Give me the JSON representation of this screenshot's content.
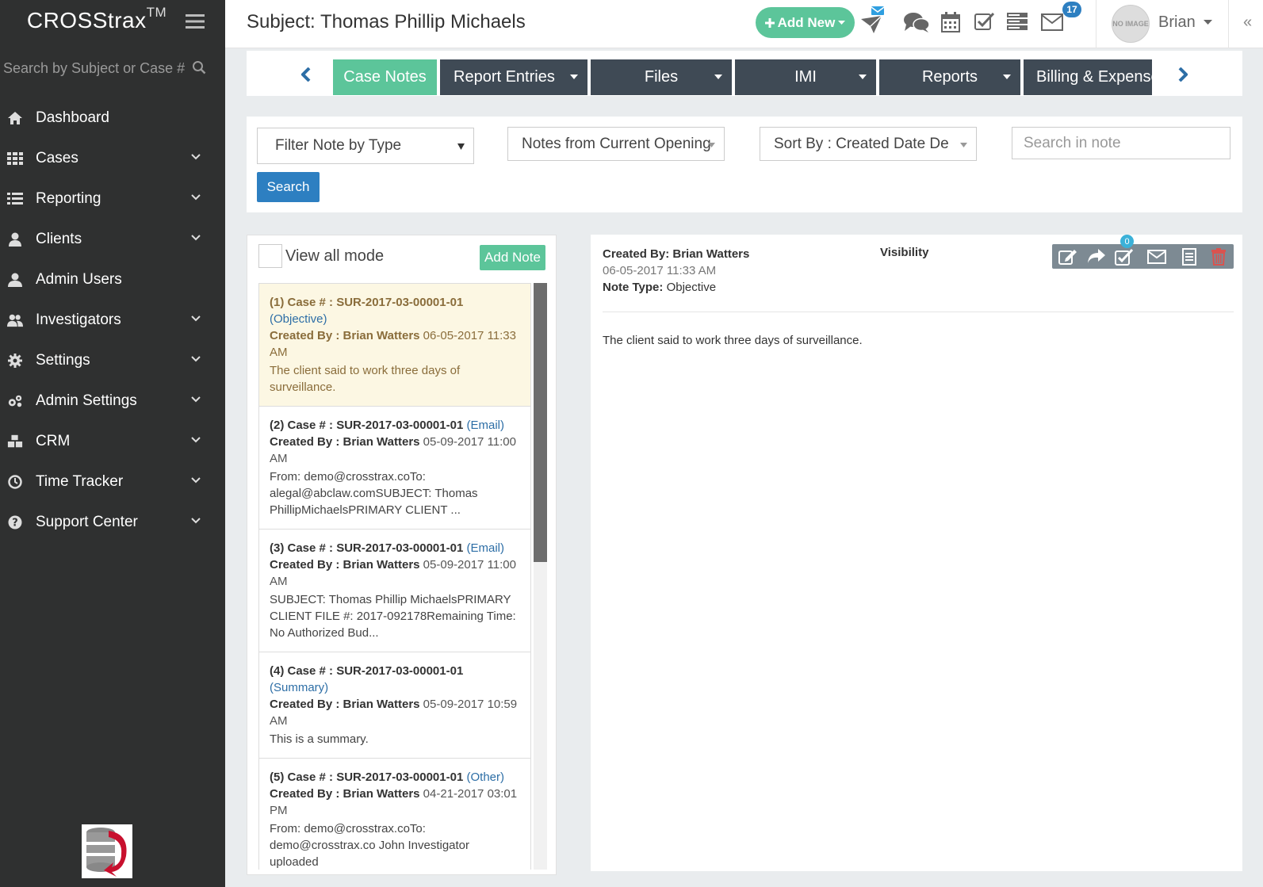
{
  "sidebar": {
    "brand": "CROSStrax",
    "brand_tm": "TM",
    "search_placeholder": "Search by Subject or Case #",
    "items": [
      {
        "label": "Dashboard"
      },
      {
        "label": "Cases"
      },
      {
        "label": "Reporting"
      },
      {
        "label": "Clients"
      },
      {
        "label": "Admin Users"
      },
      {
        "label": "Investigators"
      },
      {
        "label": "Settings"
      },
      {
        "label": "Admin Settings"
      },
      {
        "label": "CRM"
      },
      {
        "label": "Time Tracker"
      },
      {
        "label": "Support Center"
      }
    ]
  },
  "header": {
    "title": "Subject: Thomas Phillip Michaels",
    "add_new_label": "Add New",
    "messages_badge": "17",
    "user_name": "Brian",
    "avatar_text": "NO IMAGE"
  },
  "tabs": [
    {
      "label": "Case Notes"
    },
    {
      "label": "Report Entries"
    },
    {
      "label": "Files"
    },
    {
      "label": "IMI"
    },
    {
      "label": "Reports"
    },
    {
      "label": "Billing & Expense"
    }
  ],
  "filters": {
    "note_type": "Filter Note by Type",
    "opening": "Notes from Current Opening",
    "sort": "Sort By : Created Date De…",
    "search_placeholder": "Search in note",
    "search_button": "Search"
  },
  "list": {
    "view_all_label": "View all mode",
    "add_note_label": "Add Note",
    "notes": [
      {
        "num": "(1) Case # : SUR-2017-03-00001-01",
        "type": "(Objective)",
        "created_label": "Created By : Brian Watters",
        "date": "06-05-2017 11:33 AM",
        "body": "The client said to work three days of surveillance."
      },
      {
        "num": "(2) Case # : SUR-2017-03-00001-01",
        "type": "(Email)",
        "created_label": "Created By : Brian Watters",
        "date": "05-09-2017 11:00 AM",
        "body": "From: demo@crosstrax.coTo: alegal@abclaw.comSUBJECT: Thomas PhillipMichaelsPRIMARY CLIENT ..."
      },
      {
        "num": "(3) Case # : SUR-2017-03-00001-01",
        "type": "(Email)",
        "created_label": "Created By : Brian Watters",
        "date": "05-09-2017 11:00 AM",
        "body": "SUBJECT: Thomas Phillip MichaelsPRIMARY CLIENT FILE #: 2017-092178Remaining Time: No Authorized Bud..."
      },
      {
        "num": "(4) Case # : SUR-2017-03-00001-01",
        "type": "(Summary)",
        "created_label": "Created By : Brian Watters",
        "date": "05-09-2017 10:59 AM",
        "body": "This is a summary."
      },
      {
        "num": "(5) Case # : SUR-2017-03-00001-01",
        "type": "(Other)",
        "created_label": "Created By : Brian Watters",
        "date": "04-21-2017 03:01 PM",
        "body": "From: demo@crosstrax.coTo: demo@crosstrax.co John Investigator uploaded"
      }
    ]
  },
  "detail": {
    "created_by_label": "Created By:",
    "created_by_value": "Brian Watters",
    "date": "06-05-2017 11:33 AM",
    "note_type_label": "Note Type:",
    "note_type_value": "Objective",
    "visibility_label": "Visibility",
    "tasks_badge": "0",
    "body": "The client said to work three days of surveillance."
  },
  "colors": {
    "sidebar_bg": "#2f3030",
    "accent_green": "#5cc59a",
    "tab_dark": "#3f4a55",
    "primary_blue": "#2d7fc1",
    "active_note_bg": "#fcf7e3"
  }
}
